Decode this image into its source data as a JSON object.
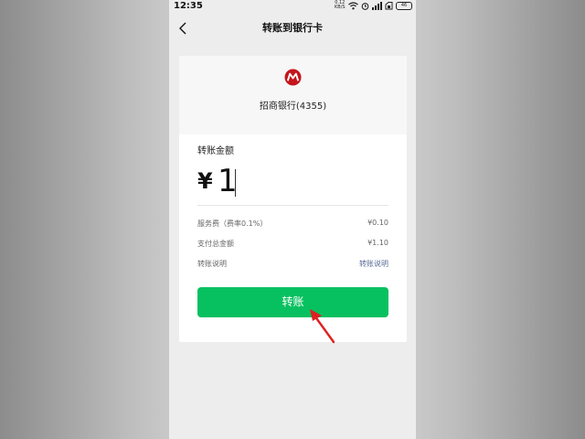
{
  "status_bar": {
    "time": "12:35",
    "net_speed": "0.12",
    "net_unit": "KB/S",
    "battery": "46"
  },
  "header": {
    "title": "转账到银行卡"
  },
  "bank": {
    "name": "招商银行(4355)",
    "logo_color": "#c4161c"
  },
  "amount": {
    "label": "转账金额",
    "currency": "¥",
    "value": "1"
  },
  "details": [
    {
      "label": "服务费（费率0.1%）",
      "value": "¥0.10"
    },
    {
      "label": "支付总金额",
      "value": "¥1.10"
    },
    {
      "label": "转账说明",
      "value": "转账说明"
    }
  ],
  "actions": {
    "transfer_label": "转账",
    "button_color": "#07c160",
    "annotation_arrow_color": "#e02020"
  }
}
